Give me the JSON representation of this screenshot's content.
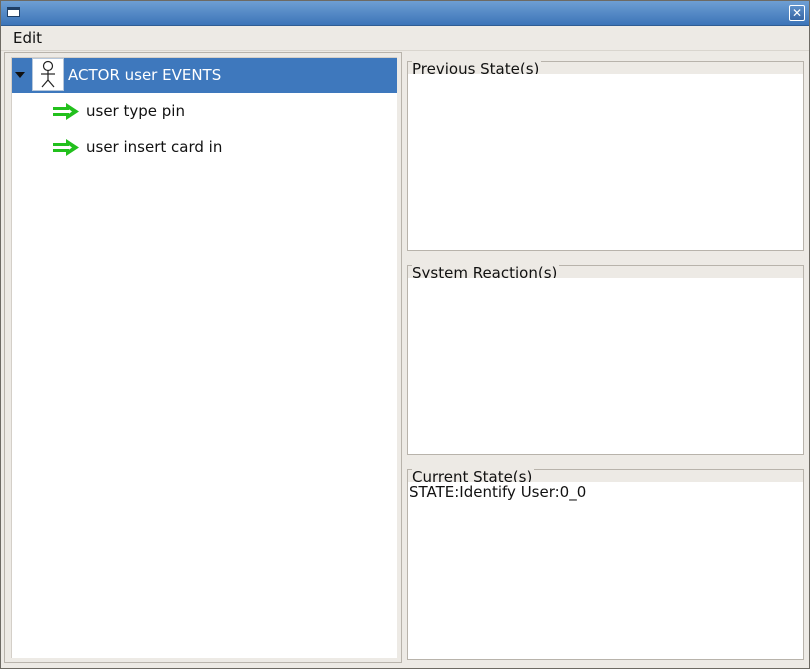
{
  "window": {
    "title": "",
    "close_glyph": "✕"
  },
  "menubar": {
    "items": [
      {
        "label": "Edit"
      }
    ]
  },
  "tree": {
    "root": {
      "label": "ACTOR user EVENTS",
      "icon": "actor-icon",
      "expanded": true,
      "selected": true
    },
    "children": [
      {
        "label": "user type pin",
        "icon": "green-arrow-icon"
      },
      {
        "label": "user insert card in",
        "icon": "green-arrow-icon"
      }
    ]
  },
  "panels": {
    "previous_states": {
      "title": "Previous State(s)",
      "items": []
    },
    "system_reactions": {
      "title": "System Reaction(s)",
      "items": []
    },
    "current_states": {
      "title": "Current State(s)",
      "items": [
        "STATE:Identify User:0_0"
      ]
    }
  },
  "colors": {
    "titlebar": "#3c74b8",
    "selection": "#3e78bd",
    "arrow": "#22c01d",
    "background": "#edeae5"
  }
}
